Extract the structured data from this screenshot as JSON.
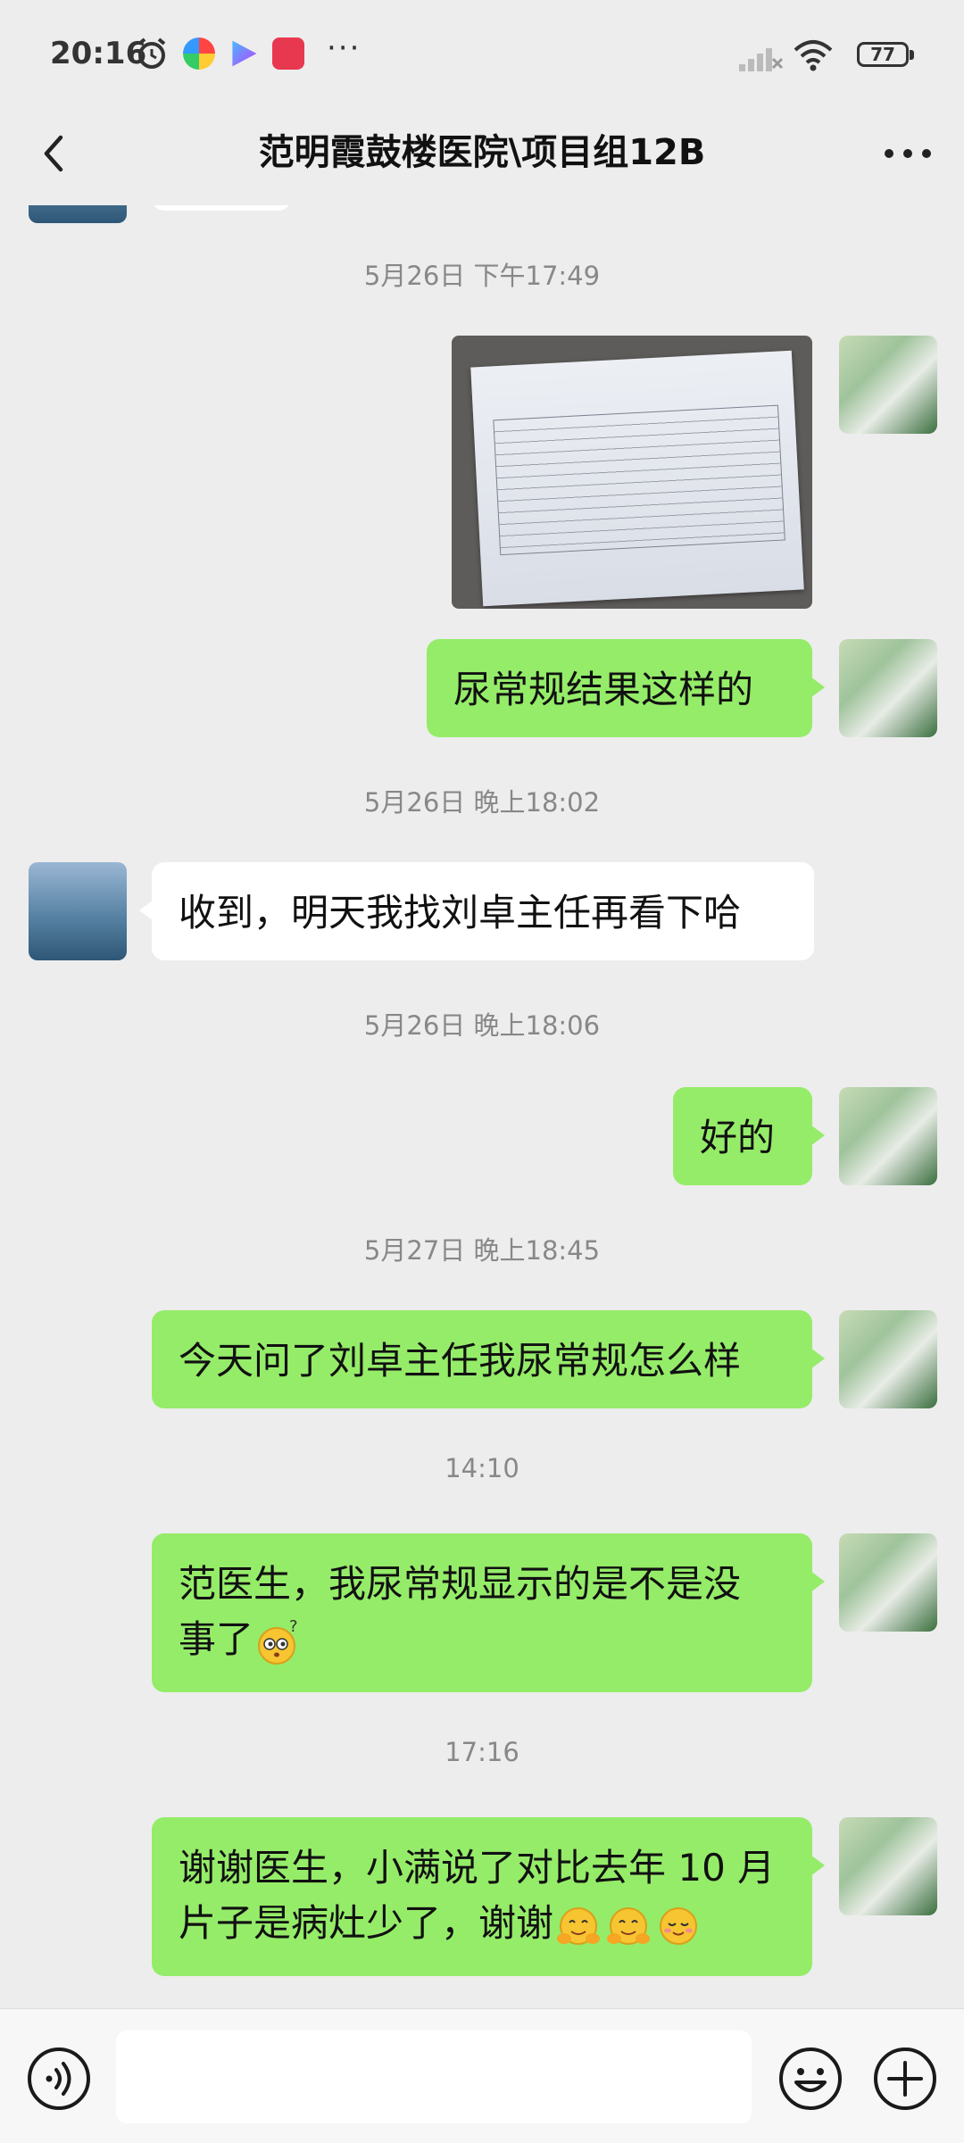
{
  "status_bar": {
    "time": "20:16",
    "dots": "···",
    "battery": "77"
  },
  "header": {
    "title": "范明霞鼓楼医院\\项目组12B"
  },
  "timestamps": {
    "t1": "5月26日 下午17:49",
    "t2": "5月26日 晚上18:02",
    "t3": "5月26日 晚上18:06",
    "t4": "5月27日 晚上18:45",
    "t5": "14:10",
    "t6": "17:16"
  },
  "messages": {
    "m1": "尿常规结果这样的",
    "m2": "收到，明天我找刘卓主任再看下哈",
    "m3": "好的",
    "m4": "今天问了刘卓主任我尿常规怎么样",
    "m5_line1": "范医生，我尿常规显示的是不是没",
    "m5_line2": "事了",
    "m6_line1": "谢谢医生，小满说了对比去年 10 月",
    "m6_line2": "片子是病灶少了，谢谢"
  },
  "icons": {
    "back": "back-arrow-icon",
    "more": "more-dots-icon",
    "voice": "voice-icon",
    "emoji": "emoji-icon",
    "plus": "plus-icon"
  },
  "colors": {
    "my_bubble": "#95ec69",
    "their_bubble": "#ffffff",
    "background": "#ededed"
  }
}
